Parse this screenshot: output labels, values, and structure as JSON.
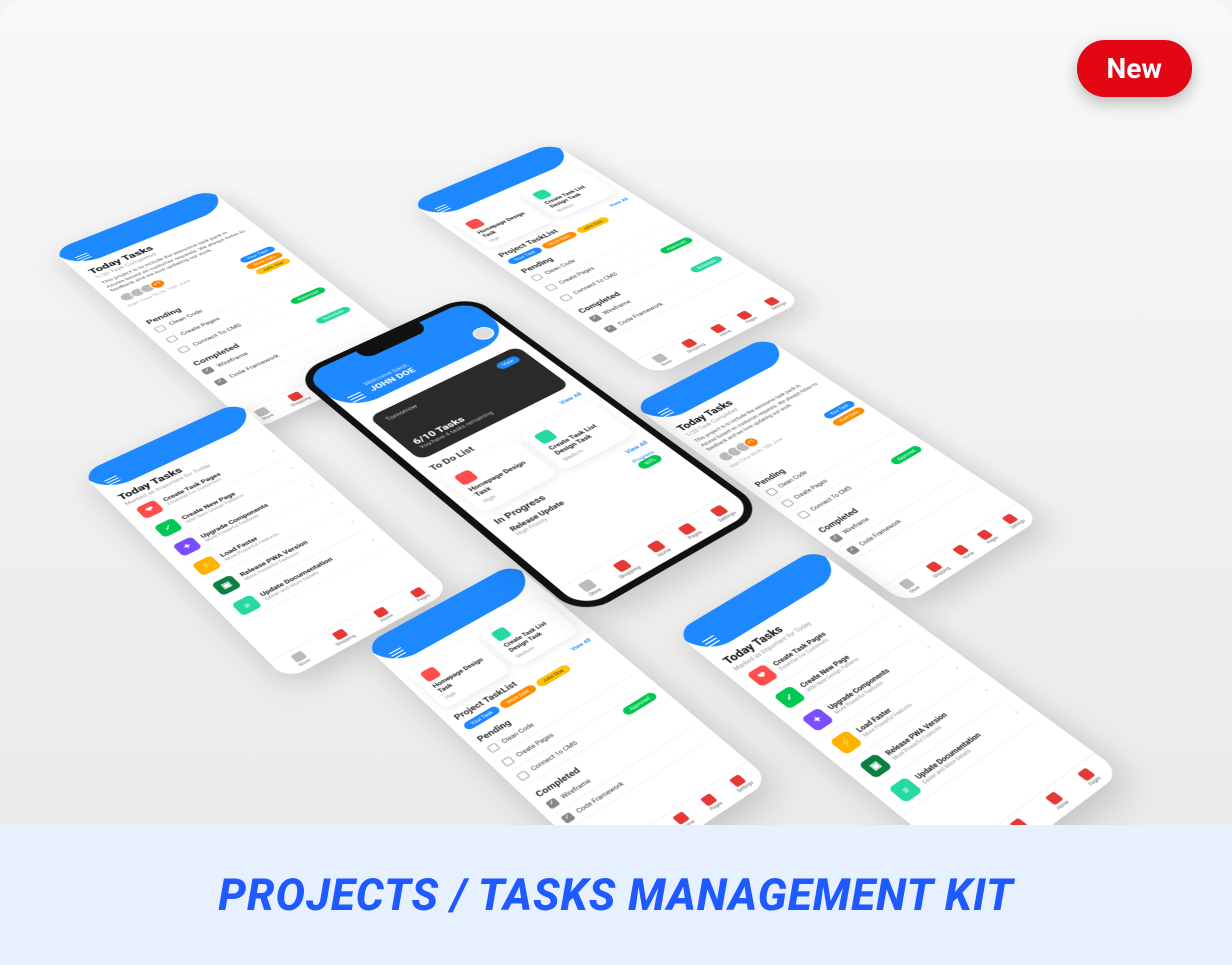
{
  "badge": {
    "label": "New"
  },
  "footer": {
    "title": "PROJECTS / TASKS MANAGEMENT KIT"
  },
  "common": {
    "view_all": "View All",
    "pending": "Pending",
    "completed": "Completed",
    "in_progress": "In Progress"
  },
  "pills": {
    "your_task": "Your Task",
    "work_date": "Work Date",
    "john_doe": "John Doe",
    "approved": "Approved",
    "schedule": "Schedule"
  },
  "nav": {
    "store": "Store",
    "shopping": "Shopping",
    "home": "Home",
    "pages": "Pages",
    "settings": "Settings"
  },
  "screens": {
    "today_tasks_detail": {
      "title": "Today Tasks",
      "subtitle": "1/20 Task Completed",
      "description": "This project is to include the awesome task pack in Azures based on customer requests. We always listen to feedback and we love updating our work.",
      "start_time": "Start Time 09:00, 10th June",
      "pending_items": [
        "Clean Code",
        "Create Pages",
        "Connect To CMS"
      ],
      "completed_items": [
        "Wireframe",
        "Code Framework"
      ]
    },
    "todo_cards": {
      "card1": {
        "title": "Homepage Design Task",
        "meta": "High"
      },
      "card2": {
        "title": "Create Task List Design Task",
        "meta": "Medium"
      },
      "project_tasklist": "Project TaskList"
    },
    "today_list": {
      "title": "Today Tasks",
      "subtitle": "Marked as Important for Today",
      "items": [
        {
          "t": "Create Task Pages",
          "s": "Essential For Customers"
        },
        {
          "t": "Create New Page",
          "s": "With New Design Patterns"
        },
        {
          "t": "Upgrade Components",
          "s": "More Powerful Features"
        },
        {
          "t": "Load Faster",
          "s": "More Powerful Features"
        },
        {
          "t": "Release PWA Version",
          "s": "More Powerful Features"
        },
        {
          "t": "Update Documentation",
          "s": "Easier and More Details"
        }
      ]
    },
    "main_phone": {
      "welcome": "Welcome back,",
      "user": "JOHN DOE",
      "tomorrow": "Tomorrow",
      "view": "View",
      "tasks_count": "6/10 Tasks",
      "tasks_remaining": "You have 4 tasks remaining",
      "todo_list": "To Do List",
      "release_update": "Release Update",
      "high_priority": "High Priority",
      "progress": "Progress",
      "progress_val": "90%"
    }
  }
}
